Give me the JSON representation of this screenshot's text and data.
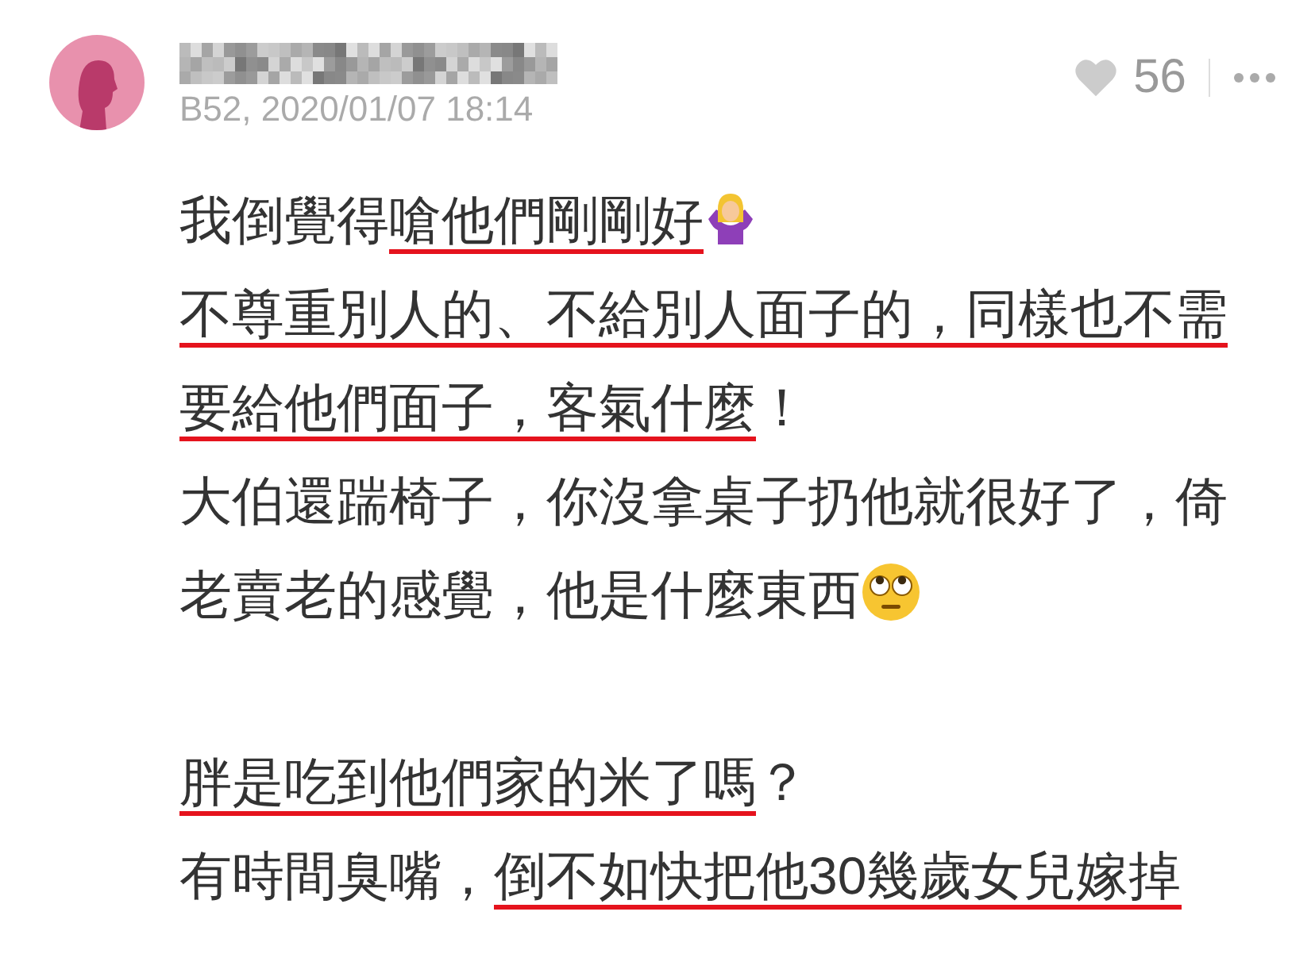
{
  "comment": {
    "meta": "B52, 2020/01/07 18:14",
    "likes": "56",
    "paragraphs": [
      [
        {
          "segments": [
            {
              "kind": "text",
              "text": "我倒覺得",
              "underlined": false
            },
            {
              "kind": "text",
              "text": "嗆他們剛剛好",
              "underlined": true
            },
            {
              "kind": "shrug"
            }
          ]
        },
        {
          "segments": [
            {
              "kind": "text",
              "text": "不尊重別人的、不給別人面子的，同樣也不需",
              "underlined": true
            }
          ]
        },
        {
          "segments": [
            {
              "kind": "text",
              "text": "要給他們面子，客氣什麼",
              "underlined": true
            },
            {
              "kind": "text",
              "text": "！",
              "underlined": false
            }
          ]
        },
        {
          "segments": [
            {
              "kind": "text",
              "text": "大伯還踹椅子，你沒拿桌子扔他就很好了，倚",
              "underlined": false
            }
          ]
        },
        {
          "segments": [
            {
              "kind": "text",
              "text": "老賣老的感覺，他是什麼東西",
              "underlined": false
            },
            {
              "kind": "eyeroll"
            }
          ]
        }
      ],
      [
        {
          "segments": [
            {
              "kind": "text",
              "text": "胖是吃到他們家的米了嗎",
              "underlined": true
            },
            {
              "kind": "text",
              "text": "？",
              "underlined": false
            }
          ]
        },
        {
          "segments": [
            {
              "kind": "text",
              "text": "有時間臭嘴，",
              "underlined": false
            },
            {
              "kind": "text",
              "text": "倒不如快把他30幾歲女兒嫁掉",
              "underlined": true
            }
          ]
        }
      ]
    ]
  }
}
